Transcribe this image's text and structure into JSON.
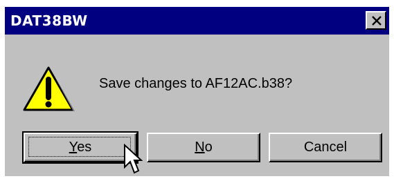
{
  "window": {
    "title": "DAT38BW"
  },
  "message": {
    "text": "Save changes to AF12AC.b38?"
  },
  "buttons": {
    "yes_accel": "Y",
    "yes_rest": "es",
    "no_accel": "N",
    "no_rest": "o",
    "cancel_label": "Cancel"
  },
  "icons": {
    "warning": "warning-icon",
    "close": "close-icon",
    "cursor": "mouse-pointer-icon"
  },
  "colors": {
    "titlebar": "#000080",
    "face": "#c0c0c0",
    "warning_fill": "#ffff00"
  }
}
